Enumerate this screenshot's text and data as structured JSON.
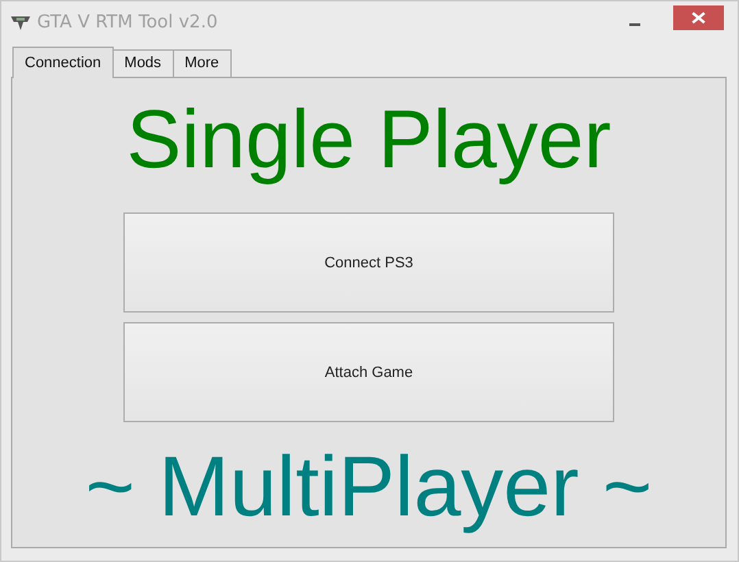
{
  "window": {
    "title": "GTA V RTM Tool v2.0"
  },
  "tabs": [
    {
      "label": "Connection",
      "selected": true
    },
    {
      "label": "Mods",
      "selected": false
    },
    {
      "label": "More",
      "selected": false
    }
  ],
  "heading": "Single Player",
  "buttons": [
    "Connect PS3",
    "Attach Game"
  ],
  "footer": "~ MultiPlayer ~"
}
